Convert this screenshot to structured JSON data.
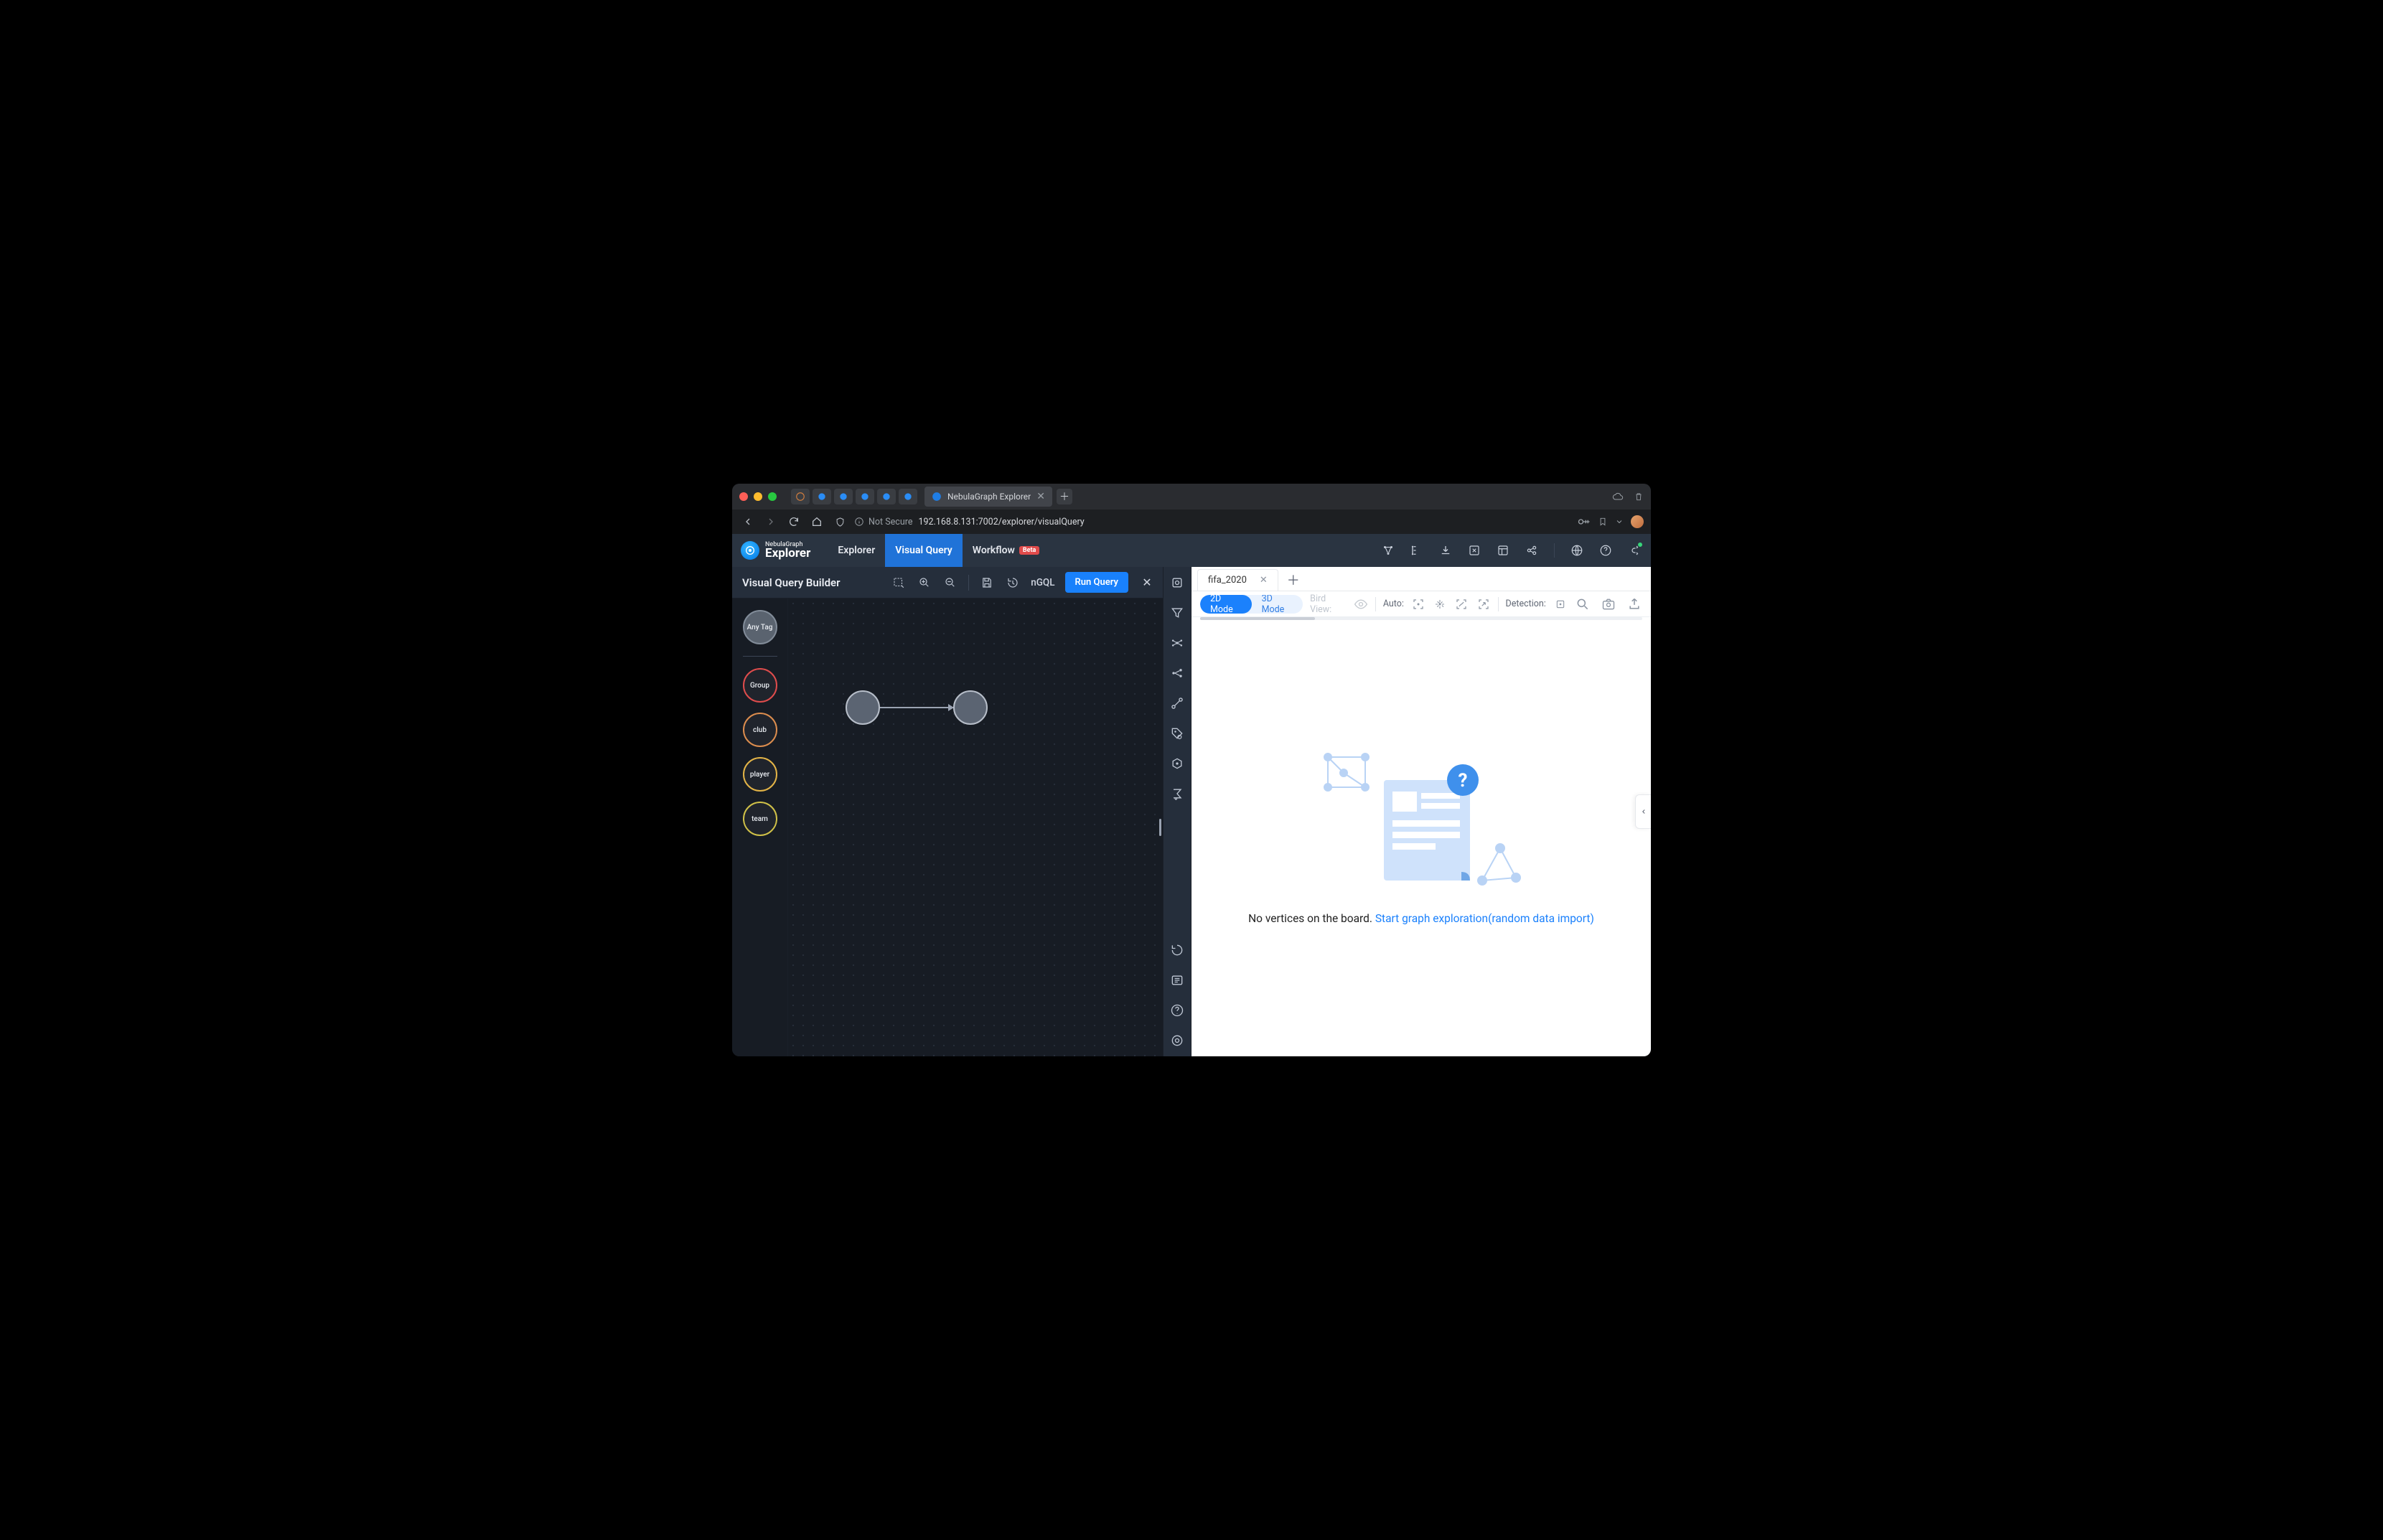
{
  "browser": {
    "tab_title": "NebulaGraph Explorer",
    "url_not_secure_label": "Not Secure",
    "url": "192.168.8.131:7002/explorer/visualQuery"
  },
  "brand": {
    "small": "NebulaGraph",
    "large": "Explorer"
  },
  "nav": {
    "explorer": "Explorer",
    "visual_query": "Visual Query",
    "workflow": "Workflow",
    "workflow_badge": "Beta"
  },
  "sub_toolbar": {
    "title": "Visual Query Builder",
    "ngql_label": "nGQL",
    "run_label": "Run Query"
  },
  "tags": {
    "any": "Any Tag",
    "group": "Group",
    "club": "club",
    "player": "player",
    "team": "team"
  },
  "result_tab": {
    "name": "fifa_2020"
  },
  "modes": {
    "two_d": "2D Mode",
    "three_d": "3D Mode"
  },
  "rtoolbar": {
    "bird_view": "Bird View:",
    "auto": "Auto:",
    "detection": "Detection:"
  },
  "empty_state": {
    "text": "No vertices on the board. ",
    "link": "Start graph exploration(random data import)"
  }
}
